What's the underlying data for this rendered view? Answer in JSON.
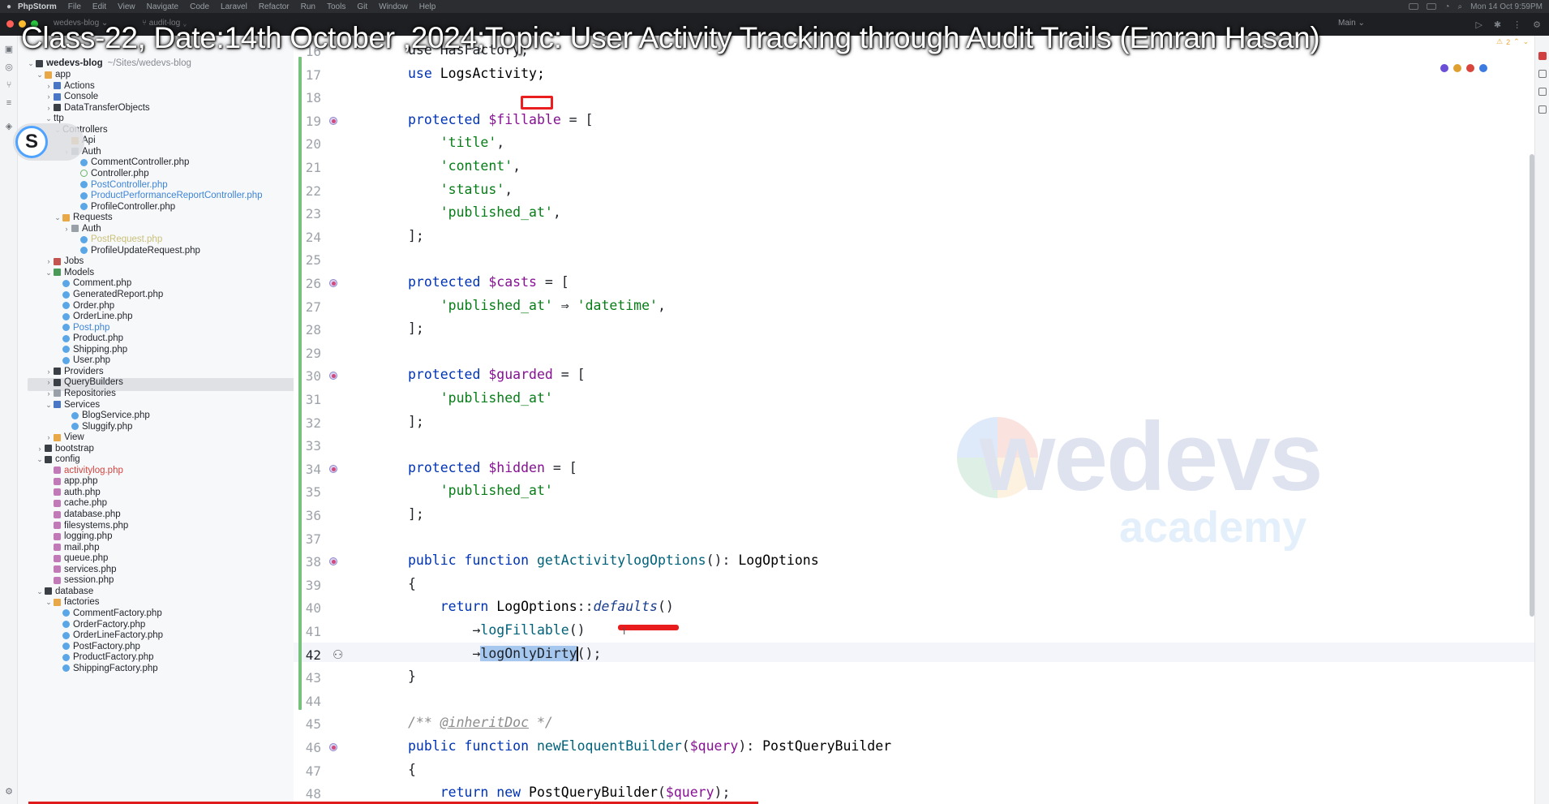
{
  "menubar": {
    "app_name": "PhpStorm",
    "items": [
      "File",
      "Edit",
      "View",
      "Navigate",
      "Code",
      "Laravel",
      "Refactor",
      "Run",
      "Tools",
      "Git",
      "Window",
      "Help"
    ],
    "datetime": "Mon 14 Oct 9:59PM"
  },
  "toolbar": {
    "project": "wedevs-blog",
    "branch": "audit-log",
    "run_config": "Main"
  },
  "overlay_title": "Class-22, Date:14th October ,2024;Topic: User Activity Tracking through Audit Trails (Emran Hasan)",
  "avatar_letter": "S",
  "project_tree": {
    "root_name": "wedevs-blog",
    "root_path": "~/Sites/wedevs-blog",
    "items": [
      {
        "label": "app",
        "indent": 1,
        "chev": "down",
        "icon": "folder-orange"
      },
      {
        "label": "Actions",
        "indent": 2,
        "chev": "right",
        "icon": "folder"
      },
      {
        "label": "Console",
        "indent": 2,
        "chev": "right",
        "icon": "folder"
      },
      {
        "label": "DataTransferObjects",
        "indent": 2,
        "chev": "right",
        "icon": "folder-dark"
      },
      {
        "label": "ttp",
        "indent": 2,
        "chev": "down",
        "icon": "none"
      },
      {
        "label": "Controllers",
        "indent": 3,
        "chev": "down",
        "icon": "none"
      },
      {
        "label": "Api",
        "indent": 4,
        "chev": "none",
        "icon": "folder-orange"
      },
      {
        "label": "Auth",
        "indent": 4,
        "chev": "right",
        "icon": "folder-gray"
      },
      {
        "label": "CommentController.php",
        "indent": 5,
        "chev": "none",
        "icon": "php"
      },
      {
        "label": "Controller.php",
        "indent": 5,
        "chev": "none",
        "icon": "php-open"
      },
      {
        "label": "PostController.php",
        "indent": 5,
        "chev": "none",
        "icon": "php",
        "color": "blue"
      },
      {
        "label": "ProductPerformanceReportController.php",
        "indent": 5,
        "chev": "none",
        "icon": "php",
        "color": "blue"
      },
      {
        "label": "ProfileController.php",
        "indent": 5,
        "chev": "none",
        "icon": "php"
      },
      {
        "label": "Requests",
        "indent": 3,
        "chev": "down",
        "icon": "folder-orange"
      },
      {
        "label": "Auth",
        "indent": 4,
        "chev": "right",
        "icon": "folder-gray"
      },
      {
        "label": "PostRequest.php",
        "indent": 5,
        "chev": "none",
        "icon": "php",
        "color": "yellow"
      },
      {
        "label": "ProfileUpdateRequest.php",
        "indent": 5,
        "chev": "none",
        "icon": "php"
      },
      {
        "label": "Jobs",
        "indent": 2,
        "chev": "right",
        "icon": "folder-red"
      },
      {
        "label": "Models",
        "indent": 2,
        "chev": "down",
        "icon": "folder-green"
      },
      {
        "label": "Comment.php",
        "indent": 3,
        "chev": "none",
        "icon": "php"
      },
      {
        "label": "GeneratedReport.php",
        "indent": 3,
        "chev": "none",
        "icon": "php"
      },
      {
        "label": "Order.php",
        "indent": 3,
        "chev": "none",
        "icon": "php"
      },
      {
        "label": "OrderLine.php",
        "indent": 3,
        "chev": "none",
        "icon": "php"
      },
      {
        "label": "Post.php",
        "indent": 3,
        "chev": "none",
        "icon": "php",
        "color": "blue"
      },
      {
        "label": "Product.php",
        "indent": 3,
        "chev": "none",
        "icon": "php"
      },
      {
        "label": "Shipping.php",
        "indent": 3,
        "chev": "none",
        "icon": "php"
      },
      {
        "label": "User.php",
        "indent": 3,
        "chev": "none",
        "icon": "php"
      },
      {
        "label": "Providers",
        "indent": 2,
        "chev": "right",
        "icon": "folder-dark"
      },
      {
        "label": "QueryBuilders",
        "indent": 2,
        "chev": "right",
        "icon": "folder-dark"
      },
      {
        "label": "Repositories",
        "indent": 2,
        "chev": "right",
        "icon": "folder-gray"
      },
      {
        "label": "Services",
        "indent": 2,
        "chev": "down",
        "icon": "folder"
      },
      {
        "label": "BlogService.php",
        "indent": 4,
        "chev": "none",
        "icon": "php"
      },
      {
        "label": "Sluggify.php",
        "indent": 4,
        "chev": "none",
        "icon": "php"
      },
      {
        "label": "View",
        "indent": 2,
        "chev": "right",
        "icon": "folder-orange"
      },
      {
        "label": "bootstrap",
        "indent": 1,
        "chev": "right",
        "icon": "folder-dark"
      },
      {
        "label": "config",
        "indent": 1,
        "chev": "down",
        "icon": "folder-dark"
      },
      {
        "label": "activitylog.php",
        "indent": 2,
        "chev": "none",
        "icon": "cfg",
        "color": "red"
      },
      {
        "label": "app.php",
        "indent": 2,
        "chev": "none",
        "icon": "cfg"
      },
      {
        "label": "auth.php",
        "indent": 2,
        "chev": "none",
        "icon": "cfg"
      },
      {
        "label": "cache.php",
        "indent": 2,
        "chev": "none",
        "icon": "cfg"
      },
      {
        "label": "database.php",
        "indent": 2,
        "chev": "none",
        "icon": "cfg"
      },
      {
        "label": "filesystems.php",
        "indent": 2,
        "chev": "none",
        "icon": "cfg"
      },
      {
        "label": "logging.php",
        "indent": 2,
        "chev": "none",
        "icon": "cfg"
      },
      {
        "label": "mail.php",
        "indent": 2,
        "chev": "none",
        "icon": "cfg"
      },
      {
        "label": "queue.php",
        "indent": 2,
        "chev": "none",
        "icon": "cfg"
      },
      {
        "label": "services.php",
        "indent": 2,
        "chev": "none",
        "icon": "cfg"
      },
      {
        "label": "session.php",
        "indent": 2,
        "chev": "none",
        "icon": "cfg"
      },
      {
        "label": "database",
        "indent": 1,
        "chev": "down",
        "icon": "folder-dark"
      },
      {
        "label": "factories",
        "indent": 2,
        "chev": "down",
        "icon": "folder-orange"
      },
      {
        "label": "CommentFactory.php",
        "indent": 3,
        "chev": "none",
        "icon": "php"
      },
      {
        "label": "OrderFactory.php",
        "indent": 3,
        "chev": "none",
        "icon": "php"
      },
      {
        "label": "OrderLineFactory.php",
        "indent": 3,
        "chev": "none",
        "icon": "php"
      },
      {
        "label": "PostFactory.php",
        "indent": 3,
        "chev": "none",
        "icon": "php"
      },
      {
        "label": "ProductFactory.php",
        "indent": 3,
        "chev": "none",
        "icon": "php"
      },
      {
        "label": "ShippingFactory.php",
        "indent": 3,
        "chev": "none",
        "icon": "php"
      }
    ]
  },
  "editor": {
    "current_line": "42",
    "lines": [
      {
        "n": "16",
        "tokens": [
          [
            "op",
            "use HasFactory;"
          ]
        ]
      },
      {
        "n": "17",
        "tokens": [
          [
            "kw",
            "use "
          ],
          [
            "cls",
            "LogsActivity;"
          ]
        ]
      },
      {
        "n": "18",
        "tokens": []
      },
      {
        "n": "19",
        "mark": true,
        "tokens": [
          [
            "kw",
            "protected "
          ],
          [
            "var",
            "$fillable"
          ],
          [
            "op",
            " = ["
          ]
        ]
      },
      {
        "n": "20",
        "tokens": [
          [
            "op",
            "    "
          ],
          [
            "str",
            "'title'"
          ],
          [
            "op",
            ","
          ]
        ]
      },
      {
        "n": "21",
        "tokens": [
          [
            "op",
            "    "
          ],
          [
            "str",
            "'content'"
          ],
          [
            "op",
            ","
          ]
        ]
      },
      {
        "n": "22",
        "tokens": [
          [
            "op",
            "    "
          ],
          [
            "str",
            "'status'"
          ],
          [
            "op",
            ","
          ]
        ]
      },
      {
        "n": "23",
        "tokens": [
          [
            "op",
            "    "
          ],
          [
            "str",
            "'published_at'"
          ],
          [
            "op",
            ","
          ]
        ]
      },
      {
        "n": "24",
        "tokens": [
          [
            "op",
            "];"
          ]
        ]
      },
      {
        "n": "25",
        "tokens": []
      },
      {
        "n": "26",
        "mark": true,
        "tokens": [
          [
            "kw",
            "protected "
          ],
          [
            "var",
            "$casts"
          ],
          [
            "op",
            " = ["
          ]
        ]
      },
      {
        "n": "27",
        "tokens": [
          [
            "op",
            "    "
          ],
          [
            "str",
            "'published_at'"
          ],
          [
            "op",
            " ⇒ "
          ],
          [
            "str",
            "'datetime'"
          ],
          [
            "op",
            ","
          ]
        ]
      },
      {
        "n": "28",
        "tokens": [
          [
            "op",
            "];"
          ]
        ]
      },
      {
        "n": "29",
        "tokens": []
      },
      {
        "n": "30",
        "mark": true,
        "tokens": [
          [
            "kw",
            "protected "
          ],
          [
            "var",
            "$guarded"
          ],
          [
            "op",
            " = ["
          ]
        ]
      },
      {
        "n": "31",
        "tokens": [
          [
            "op",
            "    "
          ],
          [
            "str",
            "'published_at'"
          ]
        ]
      },
      {
        "n": "32",
        "tokens": [
          [
            "op",
            "];"
          ]
        ]
      },
      {
        "n": "33",
        "tokens": []
      },
      {
        "n": "34",
        "mark": true,
        "tokens": [
          [
            "kw",
            "protected "
          ],
          [
            "var",
            "$hidden"
          ],
          [
            "op",
            " = ["
          ]
        ]
      },
      {
        "n": "35",
        "tokens": [
          [
            "op",
            "    "
          ],
          [
            "str",
            "'published_at'"
          ]
        ]
      },
      {
        "n": "36",
        "tokens": [
          [
            "op",
            "];"
          ]
        ]
      },
      {
        "n": "37",
        "tokens": []
      },
      {
        "n": "38",
        "mark": true,
        "tokens": [
          [
            "kw",
            "public function "
          ],
          [
            "fn",
            "getActivitylogOptions"
          ],
          [
            "op",
            "(): "
          ],
          [
            "cls",
            "LogOptions"
          ]
        ]
      },
      {
        "n": "39",
        "tokens": [
          [
            "op",
            "{"
          ]
        ]
      },
      {
        "n": "40",
        "tokens": [
          [
            "op",
            "    "
          ],
          [
            "kw",
            "return "
          ],
          [
            "cls",
            "LogOptions"
          ],
          [
            "op",
            "::"
          ],
          [
            "it",
            "defaults"
          ],
          [
            "op",
            "()"
          ]
        ]
      },
      {
        "n": "41",
        "tokens": [
          [
            "op",
            "        →"
          ],
          [
            "fn",
            "logFillable"
          ],
          [
            "op",
            "()"
          ]
        ]
      },
      {
        "n": "42",
        "eye": true,
        "tokens": [
          [
            "op",
            "        →"
          ],
          [
            "sel",
            "logOnlyDirty"
          ],
          [
            "caret",
            ""
          ],
          [
            "op",
            "();"
          ]
        ]
      },
      {
        "n": "43",
        "tokens": [
          [
            "op",
            "}"
          ]
        ]
      },
      {
        "n": "44",
        "tokens": []
      },
      {
        "n": "45",
        "tokens": [
          [
            "cmt",
            "/** "
          ],
          [
            "cmt-tag",
            "@inheritDoc"
          ],
          [
            "cmt",
            " */"
          ]
        ]
      },
      {
        "n": "46",
        "mark": true,
        "tokens": [
          [
            "kw",
            "public function "
          ],
          [
            "fn",
            "newEloquentBuilder"
          ],
          [
            "op",
            "("
          ],
          [
            "var",
            "$query"
          ],
          [
            "op",
            "): "
          ],
          [
            "cls",
            "PostQueryBuilder"
          ]
        ]
      },
      {
        "n": "47",
        "tokens": [
          [
            "op",
            "{"
          ]
        ]
      },
      {
        "n": "48",
        "tokens": [
          [
            "op",
            "    "
          ],
          [
            "kw",
            "return new "
          ],
          [
            "cls",
            "PostQueryBuilder"
          ],
          [
            "op",
            "("
          ],
          [
            "var",
            "$query"
          ],
          [
            "op",
            ");"
          ]
        ]
      }
    ]
  },
  "watermark": {
    "brand": "wedevs",
    "sub": "academy"
  },
  "inspections": {
    "warnings": "2"
  },
  "colors": {
    "accent_blue": "#4da3ff",
    "annotation_red": "#e81c1c",
    "change_green": "#76c17c"
  }
}
